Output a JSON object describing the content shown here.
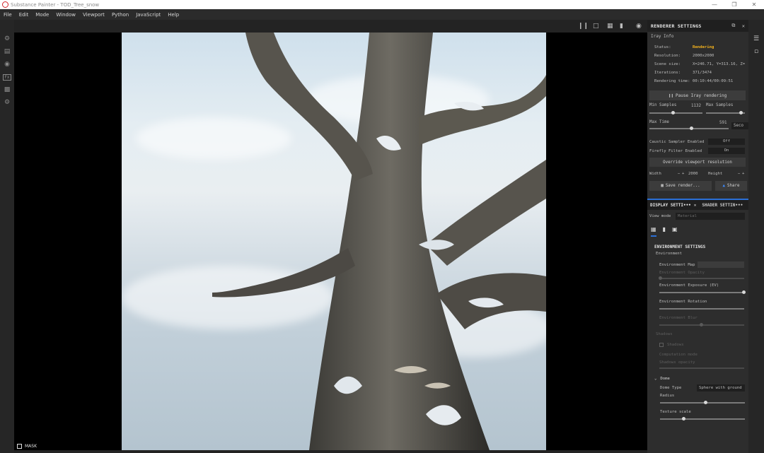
{
  "window": {
    "title": "Substance Painter - TOD_Tree_snow"
  },
  "menu": [
    "File",
    "Edit",
    "Mode",
    "Window",
    "Viewport",
    "Python",
    "JavaScript",
    "Help"
  ],
  "viewport": {
    "mask_label": "MASK"
  },
  "renderer": {
    "title": "RENDERER SETTINGS",
    "iray_info_title": "Iray Info",
    "info": [
      {
        "k": "Status:",
        "v": "Rendering"
      },
      {
        "k": "Resolution:",
        "v": "2000x2000"
      },
      {
        "k": "Scene size:",
        "v": "X=246.71, Y=313.16, Z="
      },
      {
        "k": "Iterations:",
        "v": "371/3474"
      },
      {
        "k": "Rendering time:",
        "v": "00:10:44/00:09:51"
      }
    ],
    "pause_label": "Pause Iray rendering",
    "min_samples_label": "Min Samples",
    "min_samples_value": "1132",
    "max_samples_label": "Max Samples",
    "max_time_label": "Max Time",
    "max_time_value": "591",
    "max_time_unit": "Seco",
    "caustic_label": "Caustic Sampler Enabled",
    "caustic_value": "Off",
    "firefly_label": "Firefly Filter Enabled",
    "firefly_value": "On",
    "override_label": "Override viewport resolution",
    "width_label": "Width",
    "width_value": "2000",
    "height_label": "Height",
    "save_label": "Save render...",
    "share_label": "Share"
  },
  "display": {
    "tab1": "DISPLAY SETTI•••",
    "tab2": "SHADER SETTIN•••",
    "view_mode_label": "View mode",
    "view_mode_value": "Material",
    "section": "ENVIRONMENT SETTINGS",
    "environment": "Environment",
    "env_map": "Environment Map",
    "env_opacity": "Environment Opacity",
    "env_exposure": "Environment Exposure (EV)",
    "env_rotation": "Environment Rotation",
    "env_blur": "Environment Blur",
    "shadows_group": "Shadows",
    "shadows": "Shadows",
    "comp_mode": "Computation mode",
    "shadows_opacity": "Shadows opacity",
    "dome_label": "Dome",
    "dome_type_label": "Dome Type",
    "dome_type_value": "Sphere with ground",
    "radius_label": "Radius",
    "texture_scale_label": "Texture scale"
  }
}
